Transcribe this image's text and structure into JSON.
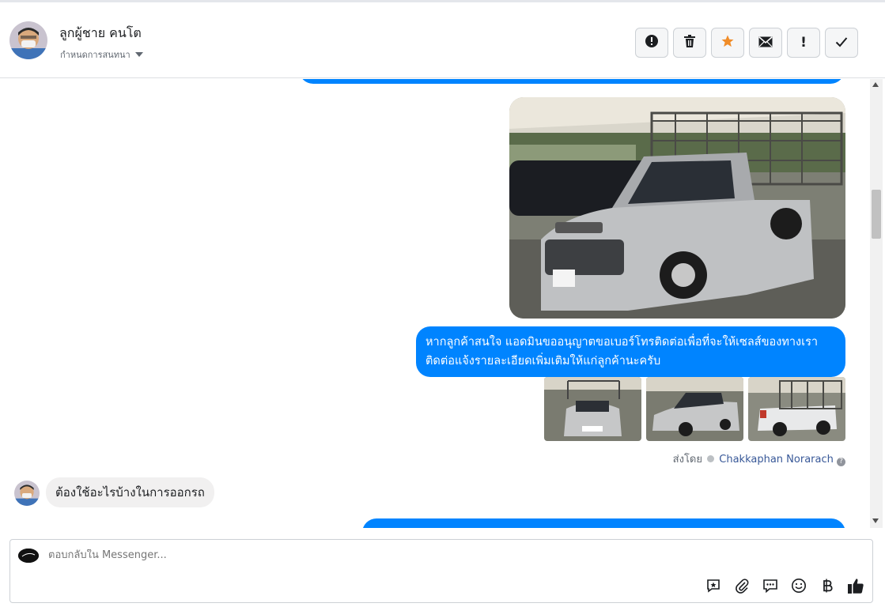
{
  "header": {
    "contact_name": "ลูกผู้ชาย คนโต",
    "label_select": "กำหนดการสนทนา",
    "actions": [
      {
        "name": "exclamation-circle-icon"
      },
      {
        "name": "trash-icon"
      },
      {
        "name": "star-icon",
        "color": "#f08c28"
      },
      {
        "name": "envelope-icon"
      },
      {
        "name": "exclamation-icon",
        "text": "!"
      },
      {
        "name": "check-icon"
      }
    ]
  },
  "thread": {
    "outgoing_message": "หากลูกค้าสนใจ แอดมินขออนุญาตขอเบอร์โทรติดต่อเพื่อที่จะให้เซลส์ของทางเราติดต่อแจ้งรายละเอียดเพิ่มเติมให้แก่ลูกค้านะครับ",
    "sent_by_prefix": "ส่งโดย",
    "sent_by_name": "Chakkaphan Norarach",
    "incoming_message": "ต้องใช้อะไรบ้างในการออกรถ"
  },
  "composer": {
    "placeholder": "ตอบกลับใน Messenger...",
    "tools": [
      "saved-reply-icon",
      "attachment-icon",
      "chat-bubbles-icon",
      "emoji-icon",
      "baht-icon",
      "thumbs-up-icon"
    ]
  },
  "colors": {
    "outgoing_bubble": "#0084ff",
    "incoming_bubble": "#f1f0f0",
    "star": "#f08c28"
  }
}
